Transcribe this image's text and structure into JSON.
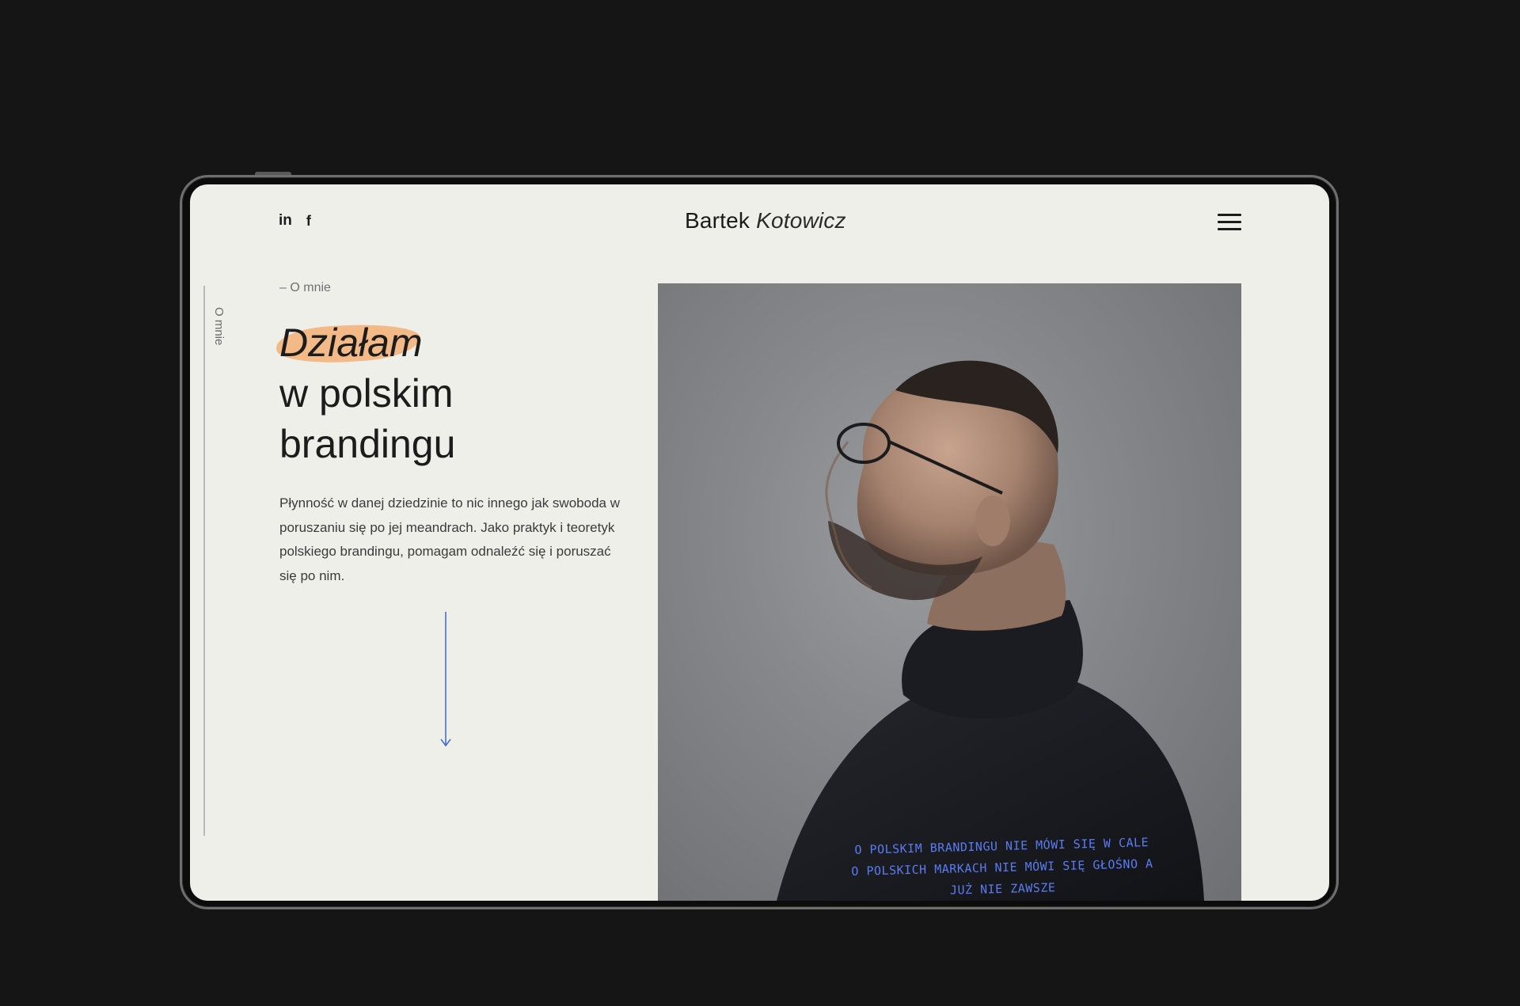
{
  "site": {
    "logo_first": "Bartek",
    "logo_last": "Kotowicz"
  },
  "social": {
    "linkedin_label": "in",
    "facebook_label": "f"
  },
  "side_nav": {
    "label": "O mnie"
  },
  "hero": {
    "section_tag": "– O mnie",
    "title_highlight": "Działam",
    "title_line2": "w polskim",
    "title_line3": "brandingu",
    "intro": "Płynność w danej dziedzinie to nic innego jak swoboda w poruszaniu się po jej meandrach. Jako praktyk i teoretyk polskiego brandingu, pomagam odnaleźć się i poruszać się po nim."
  },
  "photo": {
    "caption": "O polskim brandingu nie mówi się w cale o polskich markach nie mówi się głośno a już nie zawsze"
  },
  "colors": {
    "page_bg": "#151515",
    "screen_bg": "#efefea",
    "highlight": "#f3b27b",
    "accent_blue": "#5a7cf0"
  },
  "icons": {
    "menu": "hamburger-menu-icon",
    "scroll": "arrow-down-icon"
  }
}
